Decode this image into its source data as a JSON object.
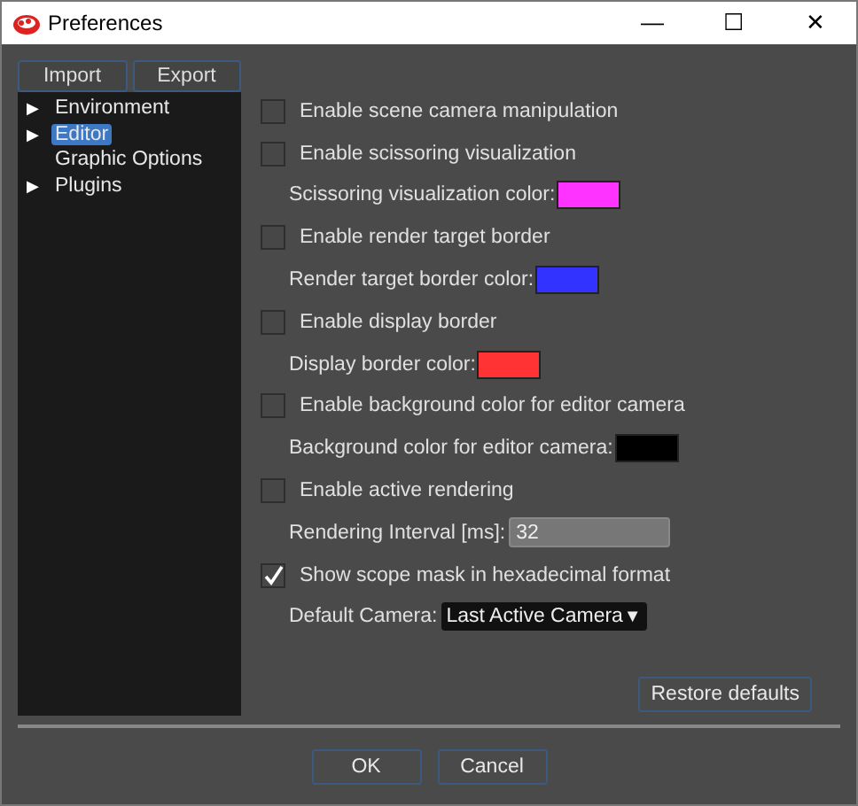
{
  "window": {
    "title": "Preferences",
    "controls": [
      "—",
      "☐",
      "✕"
    ]
  },
  "sidebar": {
    "buttons": [
      "Import",
      "Export"
    ],
    "tree": [
      {
        "toggle": "▶",
        "label": "Environment",
        "selected": false
      },
      {
        "toggle": "▶",
        "label": "Editor",
        "selected": true
      },
      {
        "label": "Graphic Options",
        "selected": false
      },
      {
        "toggle": "▶",
        "label": "Plugins",
        "selected": false
      }
    ]
  },
  "settings": [
    {
      "kind": "checkbox",
      "label": "Enable scene camera manipulation",
      "checked": false
    },
    {
      "kind": "checkbox",
      "label": "Enable scissoring visualization",
      "checked": false
    },
    {
      "kind": "color",
      "label": "Scissoring visualization color:",
      "color": "#ff33ff"
    },
    {
      "kind": "checkbox",
      "label": "Enable render target border",
      "checked": false
    },
    {
      "kind": "color",
      "label": "Render target border color:",
      "color": "#3333ff"
    },
    {
      "kind": "checkbox",
      "label": "Enable display border",
      "checked": false
    },
    {
      "kind": "color",
      "label": "Display border color:",
      "color": "#ff3333"
    },
    {
      "kind": "checkbox",
      "label": "Enable background color for editor camera",
      "checked": false
    },
    {
      "kind": "color",
      "label": "Background color for editor camera:",
      "color": "#000000"
    },
    {
      "kind": "checkbox",
      "label": "Enable active rendering",
      "checked": false
    },
    {
      "kind": "number",
      "label": "Rendering Interval [ms]:",
      "value": "32",
      "disabled": true
    },
    {
      "kind": "checkbox",
      "label": "Show scope mask in hexadecimal format",
      "checked": true
    },
    {
      "kind": "dropdown",
      "label": "Default Camera:",
      "value": "Last Active Camera",
      "caret": "▼"
    }
  ],
  "restore_button": "Restore defaults",
  "footer": {
    "buttons": [
      "OK",
      "Cancel"
    ]
  }
}
